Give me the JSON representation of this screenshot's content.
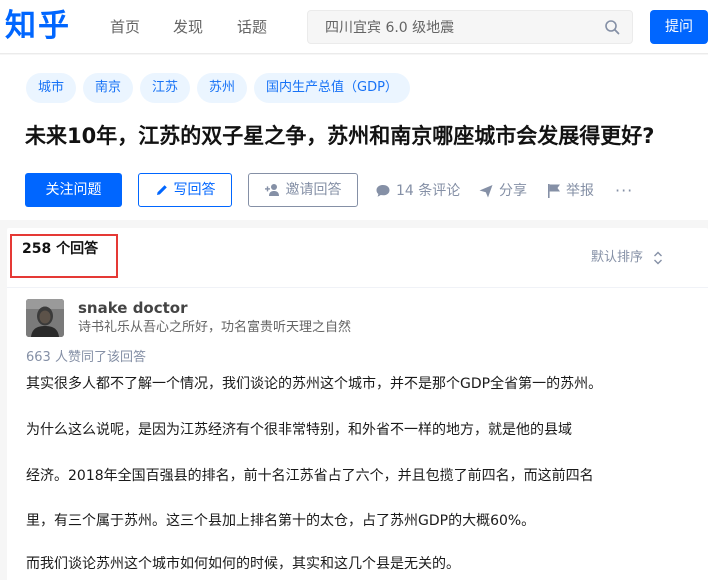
{
  "header": {
    "logo": "知乎",
    "nav": [
      "首页",
      "发现",
      "话题"
    ],
    "search_value": "四川宜宾 6.0 级地震",
    "ask_label": "提问"
  },
  "question": {
    "tags": [
      "城市",
      "南京",
      "江苏",
      "苏州",
      "国内生产总值（GDP）"
    ],
    "title": "未来10年，江苏的双子星之争，苏州和南京哪座城市会发展得更好?",
    "follow_label": "关注问题",
    "write_label": "写回答",
    "invite_label": "邀请回答",
    "comments_label": "14 条评论",
    "share_label": "分享",
    "report_label": "举报",
    "more_label": "···"
  },
  "answers": {
    "count_label": "258 个回答",
    "sort_label": "默认排序",
    "author_name": "snake doctor",
    "author_bio": "诗书礼乐从吾心之所好，功名富贵听天理之自然",
    "votes_label": "663 人赞同了该回答",
    "paragraphs": [
      "其实很多人都不了解一个情况，我们谈论的苏州这个城市，并不是那个GDP全省第一的苏州。",
      "为什么这么说呢，是因为江苏经济有个很非常特别，和外省不一样的地方，就是他的县域",
      "经济。2018年全国百强县的排名，前十名江苏省占了六个，并且包揽了前四名，而这前四名",
      "里，有三个属于苏州。这三个县加上排名第十的太仓，占了苏州GDP的大概60%。",
      "而我们谈论苏州这个城市如何如何的时候，其实和这几个县是无关的。"
    ]
  },
  "colors": {
    "brand": "#0066ff",
    "tag_bg": "#ebf5ff",
    "highlight_border": "#e53935"
  },
  "icons": [
    "search-icon",
    "pencil-icon",
    "add-user-icon",
    "comment-icon",
    "share-icon",
    "flag-icon",
    "sort-chevrons-icon"
  ]
}
